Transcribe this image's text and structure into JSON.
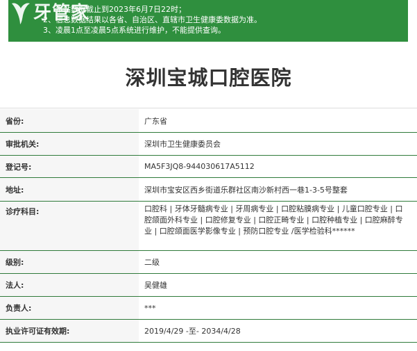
{
  "notice": {
    "lines": [
      "1、本站数据截止到2023年6月7日22时；",
      "2、信息数据结果以各省、自治区、直辖市卫生健康委数据为准。",
      "3、凌晨1点至凌晨5点系统进行维护，不能提供查询。"
    ]
  },
  "logo": {
    "text": "牙管家"
  },
  "hospital": {
    "name": "深圳宝城口腔医院"
  },
  "fields": [
    {
      "label": "省份:",
      "value": "广东省"
    },
    {
      "label": "审批机关:",
      "value": "深圳市卫生健康委员会"
    },
    {
      "label": "登记号:",
      "value": "MA5F3JQ8-944030617A5112"
    },
    {
      "label": "地址:",
      "value": "深圳市宝安区西乡街道乐群社区南沙新村西一巷1-3-5号整套"
    },
    {
      "label": "诊疗科目:",
      "value": "口腔科 | 牙体牙髓病专业 | 牙周病专业 | 口腔粘膜病专业 | 儿童口腔专业 | 口腔颌面外科专业 | 口腔修复专业 | 口腔正畸专业 | 口腔种植专业 | 口腔麻醉专业 | 口腔颌面医学影像专业 | 预防口腔专业 /医学检验科******"
    },
    {
      "label": "级别:",
      "value": "二级"
    },
    {
      "label": "法人:",
      "value": "吴健雄"
    },
    {
      "label": "负责人:",
      "value": "***"
    },
    {
      "label": "执业许可证有效期:",
      "value": "2019/4/29 -至- 2034/4/28"
    }
  ],
  "colors": {
    "notice_bg": "#2f8f3e",
    "row_border": "#2f7a3a",
    "label_bg": "#f6f6f6"
  }
}
